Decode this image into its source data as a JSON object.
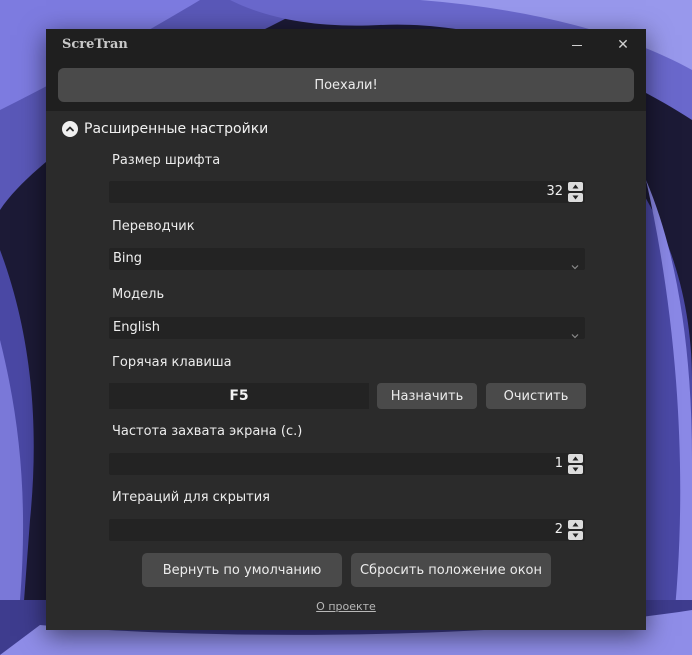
{
  "app": {
    "title": "ScreTran"
  },
  "titlebar": {
    "minimize_icon": "minimize-icon",
    "close_icon": "close-icon",
    "close_glyph": "✕"
  },
  "main": {
    "go_label": "Поехали!"
  },
  "advanced": {
    "title": "Расширенные настройки",
    "toggle_icon": "chevron-up-circle-icon",
    "font_size": {
      "label": "Размер шрифта",
      "value": "32"
    },
    "translator": {
      "label": "Переводчик",
      "value": "Bing"
    },
    "model": {
      "label": "Модель",
      "value": "English"
    },
    "hotkey": {
      "label": "Горячая клавиша",
      "value": "F5",
      "assign_label": "Назначить",
      "clear_label": "Очистить"
    },
    "capture_rate": {
      "label": "Частота захвата экрана (с.)",
      "value": "1"
    },
    "hide_iterations": {
      "label": "Итераций для скрытия",
      "value": "2"
    }
  },
  "footer": {
    "reset_defaults_label": "Вернуть по умолчанию",
    "reset_positions_label": "Сбросить положение окон",
    "about_label": "О проекте"
  },
  "colors": {
    "window_bg": "#2b2b2b",
    "titlebar_bg": "#1f1f1f",
    "button_bg": "#4a4a4a",
    "field_bg": "#232323",
    "wallpaper_accent": "#6b6bd8"
  }
}
